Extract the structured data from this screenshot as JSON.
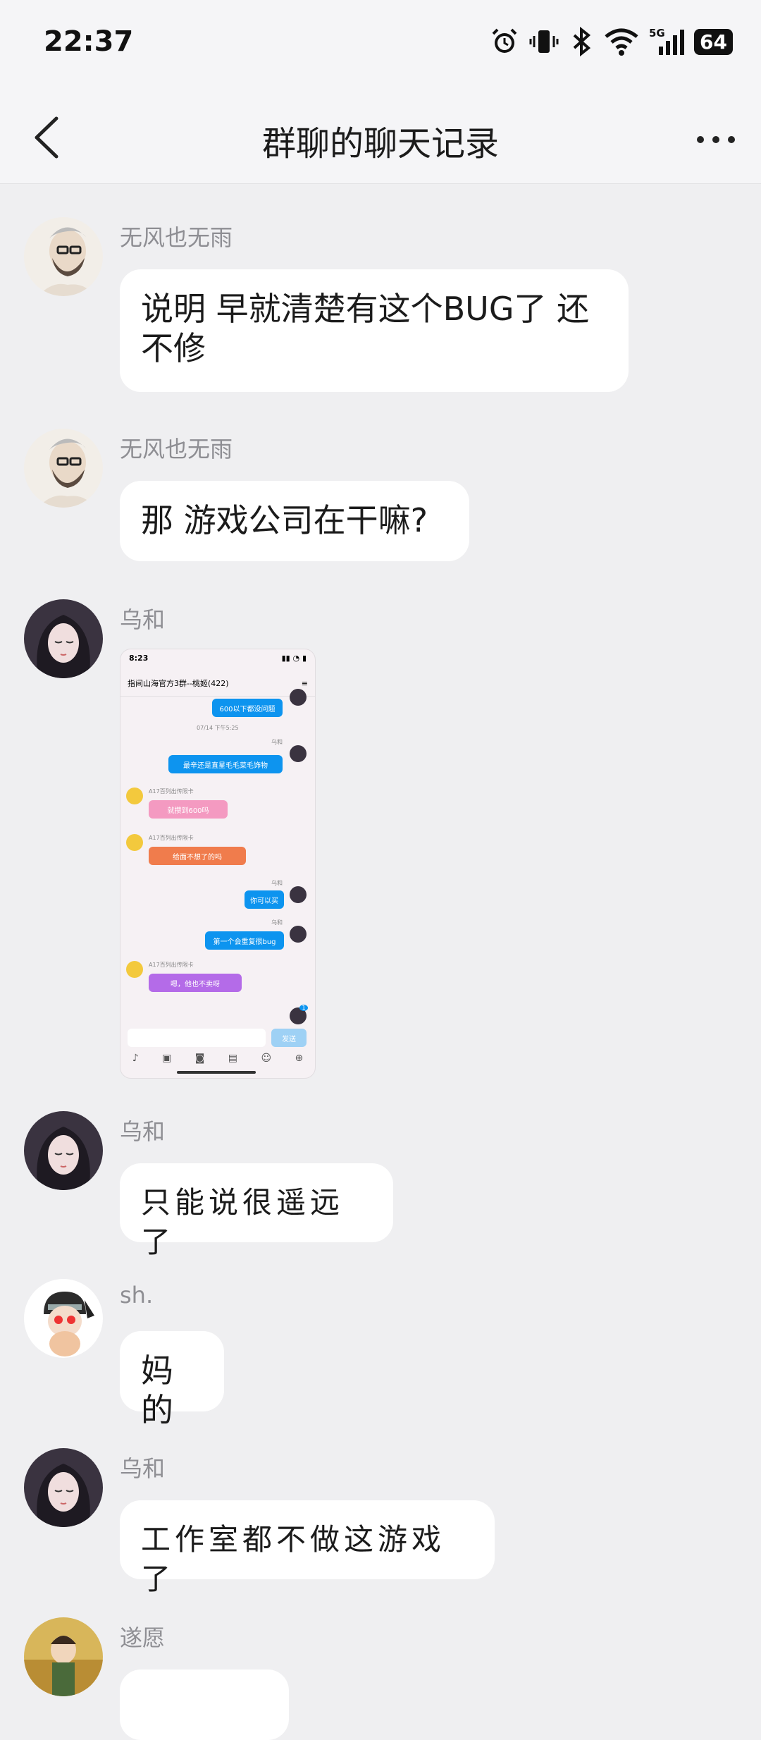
{
  "status_bar": {
    "time": "22:37",
    "battery": "64",
    "icons": [
      "alarm-icon",
      "vibrate-icon",
      "bluetooth-icon",
      "wifi-icon",
      "signal-5g-icon",
      "battery-icon"
    ]
  },
  "header": {
    "title": "群聊的聊天记录",
    "back_icon": "chevron-left-icon",
    "more_icon": "more-dots-icon"
  },
  "messages": [
    {
      "sender": "无风也无雨",
      "text": "说明 早就清楚有这个BUG了 还不修"
    },
    {
      "sender": "无风也无雨",
      "text": "那 游戏公司在干嘛?"
    },
    {
      "sender": "乌和",
      "type": "image"
    },
    {
      "sender": "乌和",
      "text": "只能说很遥远了"
    },
    {
      "sender": "sh.",
      "text": "妈的"
    },
    {
      "sender": "乌和",
      "text": "工作室都不做这游戏了"
    },
    {
      "sender": "遂愿",
      "text": ""
    }
  ],
  "screenshot_image": {
    "time": "8:23",
    "title": "指间山海官方3群--桃姬(422)",
    "timestamp": "07/14 下午5:25",
    "sender_name": "乌和",
    "other_sender": "A17百列出传限卡",
    "bubbles": [
      "600以下都没问题",
      "最辛还是直星毛毛菜毛饰物",
      "就攒到600吗",
      "给面不想了的吗",
      "你可以买",
      "第一个会重复很bug",
      "嗯，他也不卖呀"
    ],
    "send_label": "发送",
    "badge": "1"
  }
}
